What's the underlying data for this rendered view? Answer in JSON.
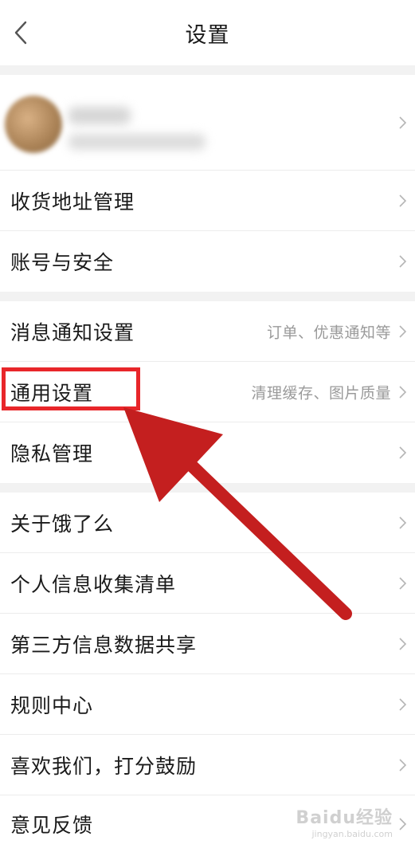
{
  "header": {
    "title": "设置"
  },
  "profile": {},
  "menu": [
    {
      "label": "收货地址管理",
      "sub": ""
    },
    {
      "label": "账号与安全",
      "sub": ""
    },
    {
      "label": "消息通知设置",
      "sub": "订单、优惠通知等"
    },
    {
      "label": "通用设置",
      "sub": "清理缓存、图片质量"
    },
    {
      "label": "隐私管理",
      "sub": ""
    },
    {
      "label": "关于饿了么",
      "sub": ""
    },
    {
      "label": "个人信息收集清单",
      "sub": ""
    },
    {
      "label": "第三方信息数据共享",
      "sub": ""
    },
    {
      "label": "规则中心",
      "sub": ""
    },
    {
      "label": "喜欢我们，打分鼓励",
      "sub": ""
    },
    {
      "label": "意见反馈",
      "sub": ""
    }
  ],
  "annotation": {
    "color": "#e8262a"
  },
  "watermark": {
    "brand": "Baidu经验",
    "url": "jingyan.baidu.com"
  }
}
